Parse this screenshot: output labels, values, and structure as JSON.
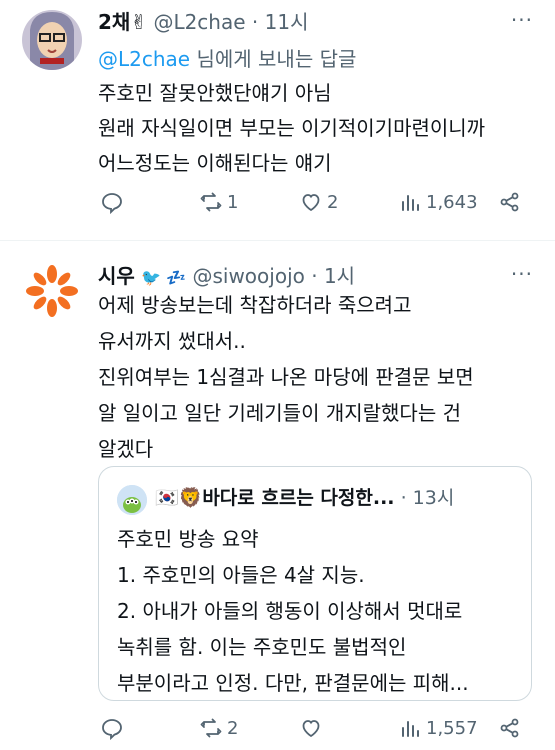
{
  "tweet1": {
    "name": "2채✌",
    "handle": "@L2chae",
    "time": "11시",
    "reply_mention": "@L2chae",
    "reply_suffix": " 님에게 보내는 답글",
    "lines": [
      "주호민 잘못안했단얘기 아님",
      "원래 자식일이면 부모는 이기적이기마련이니까",
      "어느정도는 이해된다는 얘기"
    ],
    "replies": "",
    "retweets": "1",
    "likes": "2",
    "views": "1,643"
  },
  "tweet2": {
    "name": "시우",
    "name_icons": "🐦 💤",
    "handle": "@siwoojojo",
    "time": "1시",
    "lines": [
      "어제 방송보는데 착잡하더라 죽으려고",
      "유서까지 썼대서..",
      "진위여부는 1심결과 나온 마당에 판결문 보면",
      "알 일이고 일단 기레기들이 개지랄했다는 건",
      "알겠다"
    ],
    "replies": "",
    "retweets": "2",
    "likes": "",
    "views": "1,557",
    "quote": {
      "name": "🇰🇷🦁바다로 흐르는 다정한...",
      "time": "13시",
      "lines": [
        "주호민 방송 요약",
        "1. 주호민의 아들은 4살 지능.",
        "2. 아내가 아들의 행동이 이상해서 멋대로",
        "녹취를 함. 이는 주호민도 불법적인",
        "부분이라고 인정. 다만, 판결문에는 피해..."
      ]
    }
  },
  "colors": {
    "accent": "#1d9bf0",
    "muted": "#536471",
    "text": "#0f1419",
    "border": "#cfd9de"
  }
}
